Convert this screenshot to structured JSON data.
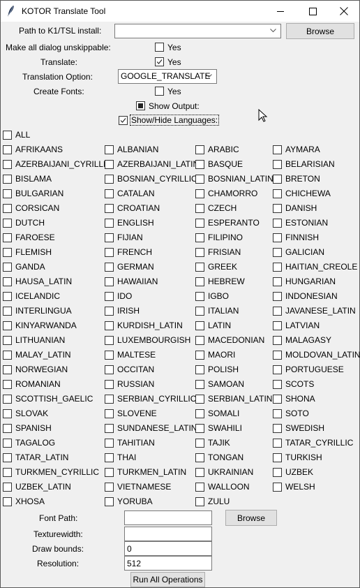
{
  "window": {
    "title": "KOTOR Translate Tool",
    "controls": {
      "minimize": "minimize",
      "maximize": "maximize",
      "close": "close"
    }
  },
  "path": {
    "label": "Path to K1/TSL install:",
    "value": "",
    "browse_label": "Browse"
  },
  "unskippable": {
    "label": "Make all dialog unskippable:",
    "check_label": "Yes",
    "checked": false
  },
  "translate": {
    "label": "Translate:",
    "check_label": "Yes",
    "checked": true
  },
  "translation_option": {
    "label": "Translation Option:",
    "value": "GOOGLE_TRANSLATE"
  },
  "create_fonts": {
    "label": "Create Fonts:",
    "check_label": "Yes",
    "checked": false
  },
  "show_output": {
    "label": "Show Output:",
    "state": "indeterminate"
  },
  "show_hide_languages": {
    "label": "Show/Hide Languages:",
    "checked": true
  },
  "all": {
    "label": "ALL",
    "checked": false
  },
  "languages": [
    "AFRIKAANS",
    "ALBANIAN",
    "ARABIC",
    "AYMARA",
    "AZERBAIJANI_CYRILLIC",
    "AZERBAIJANI_LATIN",
    "BASQUE",
    "BELARISIAN",
    "BISLAMA",
    "BOSNIAN_CYRILLIC",
    "BOSNIAN_LATIN",
    "BRETON",
    "BULGARIAN",
    "CATALAN",
    "CHAMORRO",
    "CHICHEWA",
    "CORSICAN",
    "CROATIAN",
    "CZECH",
    "DANISH",
    "DUTCH",
    "ENGLISH",
    "ESPERANTO",
    "ESTONIAN",
    "FAROESE",
    "FIJIAN",
    "FILIPINO",
    "FINNISH",
    "FLEMISH",
    "FRENCH",
    "FRISIAN",
    "GALICIAN",
    "GANDA",
    "GERMAN",
    "GREEK",
    "HAITIAN_CREOLE",
    "HAUSA_LATIN",
    "HAWAIIAN",
    "HEBREW",
    "HUNGARIAN",
    "ICELANDIC",
    "IDO",
    "IGBO",
    "INDONESIAN",
    "INTERLINGUA",
    "IRISH",
    "ITALIAN",
    "JAVANESE_LATIN",
    "KINYARWANDA",
    "KURDISH_LATIN",
    "LATIN",
    "LATVIAN",
    "LITHUANIAN",
    "LUXEMBOURGISH",
    "MACEDONIAN",
    "MALAGASY",
    "MALAY_LATIN",
    "MALTESE",
    "MAORI",
    "MOLDOVAN_LATIN",
    "NORWEGIAN",
    "OCCITAN",
    "POLISH",
    "PORTUGUESE",
    "ROMANIAN",
    "RUSSIAN",
    "SAMOAN",
    "SCOTS",
    "SCOTTISH_GAELIC",
    "SERBIAN_CYRILLIC",
    "SERBIAN_LATIN",
    "SHONA",
    "SLOVAK",
    "SLOVENE",
    "SOMALI",
    "SOTO",
    "SPANISH",
    "SUNDANESE_LATIN",
    "SWAHILI",
    "SWEDISH",
    "TAGALOG",
    "TAHITIAN",
    "TAJIK",
    "TATAR_CYRILLIC",
    "TATAR_LATIN",
    "THAI",
    "TONGAN",
    "TURKISH",
    "TURKMEN_CYRILLIC",
    "TURKMEN_LATIN",
    "UKRAINIAN",
    "UZBEK",
    "UZBEK_LATIN",
    "VIETNAMESE",
    "WALLOON",
    "WELSH",
    "XHOSA",
    "YORUBA",
    "ZULU"
  ],
  "font_path": {
    "label": "Font Path:",
    "value": "",
    "browse_label": "Browse"
  },
  "texturewidth": {
    "label": "Texturewidth:",
    "value": ""
  },
  "draw_bounds": {
    "label": "Draw bounds:",
    "value": "0"
  },
  "resolution": {
    "label": "Resolution:",
    "value": "512"
  },
  "run_button": {
    "label": "Run All Operations"
  }
}
